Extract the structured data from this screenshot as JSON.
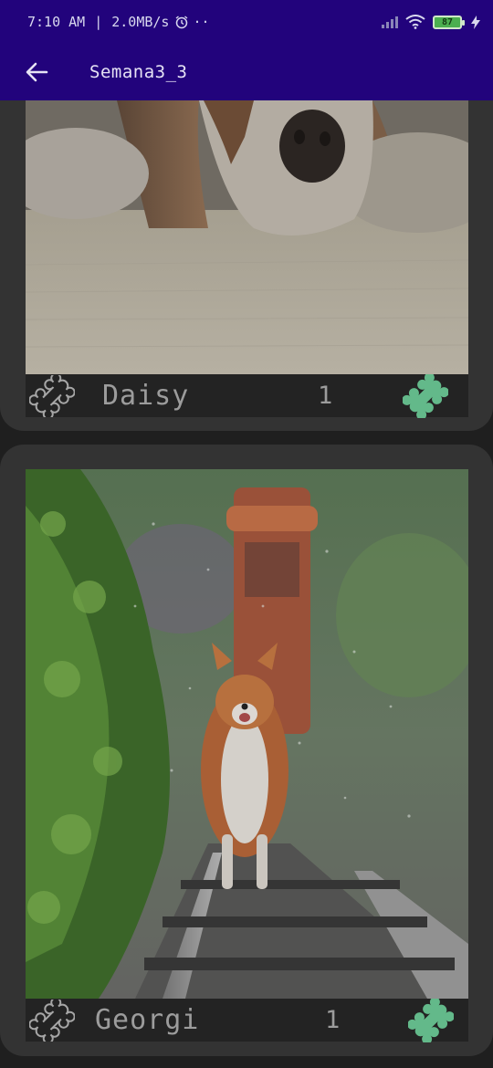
{
  "status_bar": {
    "time": "7:10 AM",
    "separator": "|",
    "speed": "2.0MB/s",
    "extra": "··",
    "battery_level": "87"
  },
  "toolbar": {
    "title": "Semana3_3",
    "back_icon": "arrow-back-icon"
  },
  "dogs": [
    {
      "name": "Daisy",
      "likes": "1",
      "rate_icon": "bone-outline-icon",
      "like_icon": "bone-filled-icon"
    },
    {
      "name": "Georgi",
      "likes": "1",
      "rate_icon": "bone-outline-icon",
      "like_icon": "bone-filled-icon"
    }
  ],
  "colors": {
    "app_bar": "#22037c",
    "card": "#333333",
    "footer": "#232323",
    "bone_filled": "#63b98a",
    "text_muted": "#9c9c9c"
  }
}
